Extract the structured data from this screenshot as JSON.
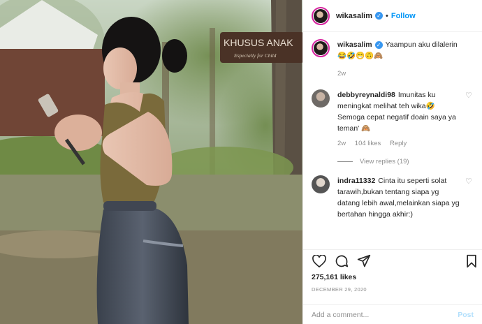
{
  "photo": {
    "sign_text": "KHUSUS ANAK",
    "sign_subtext": "Especially for Child"
  },
  "header": {
    "username": "wikasalim",
    "verified_mark": "✓",
    "separator": "•",
    "follow_label": "Follow"
  },
  "caption": {
    "username": "wikasalim",
    "text": "Yaampun aku dilalerin",
    "emojis": "😂🤣😁🙃🙈",
    "age": "2w"
  },
  "comments": [
    {
      "username": "debbyreynaldi98",
      "text": "Imunitas ku meningkat melihat teh wika🤣 Semoga cepat negatif doain saya ya teman' 🙈",
      "age": "2w",
      "likes": "104 likes",
      "reply_label": "Reply",
      "view_replies": "View replies (19)"
    },
    {
      "username": "indra11332",
      "text": "Cinta itu seperti solat tarawih,bukan tentang siapa yg datang lebih awal,melainkan siapa yg bertahan hingga akhir:)"
    }
  ],
  "stats": {
    "likes": "275,161 likes",
    "date": "DECEMBER 29, 2020"
  },
  "add_comment": {
    "placeholder": "Add a comment...",
    "post_label": "Post"
  },
  "colors": {
    "accent": "#0095f6",
    "verified": "#3897f0",
    "muted": "#8e8e8e"
  },
  "icons": [
    "heart-icon",
    "comment-icon",
    "share-icon",
    "bookmark-icon",
    "verified-badge"
  ]
}
